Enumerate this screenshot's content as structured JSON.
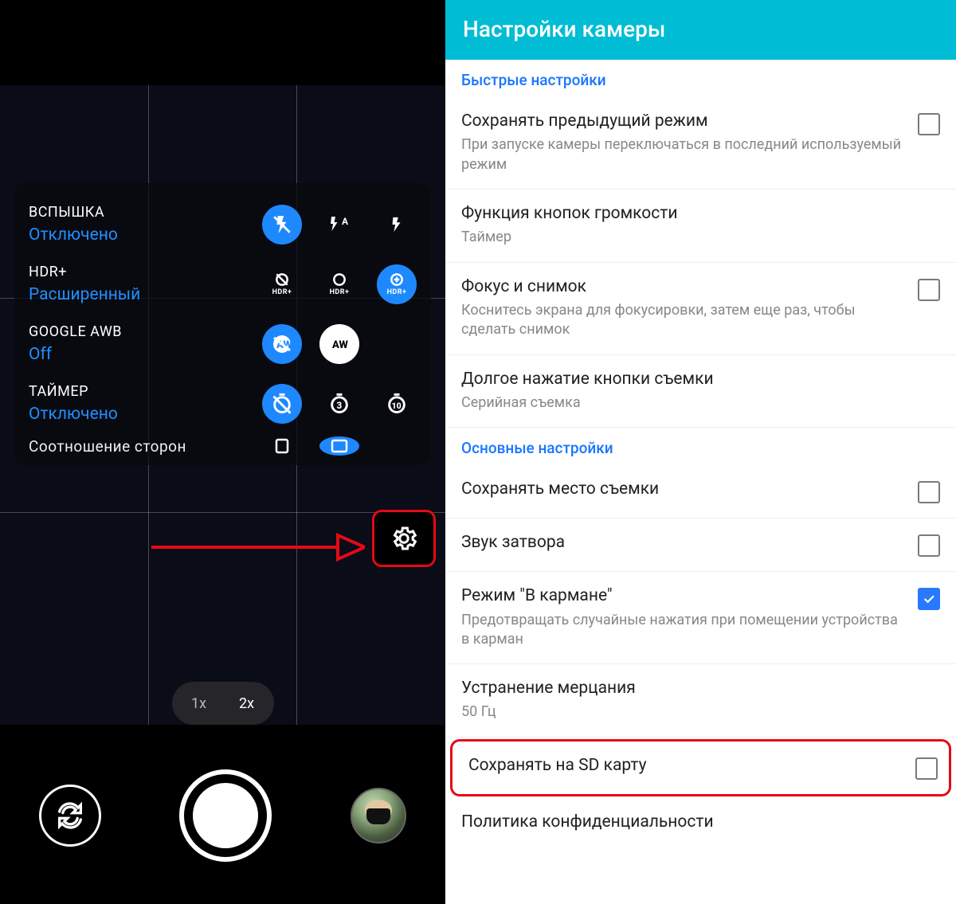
{
  "camera": {
    "quick": {
      "flash": {
        "label": "ВСПЫШКА",
        "value": "Отключено"
      },
      "hdr": {
        "label": "HDR+",
        "value": "Расширенный"
      },
      "awb": {
        "label": "GOOGLE AWB",
        "value": "Off"
      },
      "timer": {
        "label": "ТАЙМЕР",
        "value": "Отключено"
      },
      "aspect": {
        "label": "Соотношение сторон"
      }
    },
    "zoom": {
      "x1": "1x",
      "x2": "2x"
    }
  },
  "settings": {
    "appbar": "Настройки камеры",
    "section_quick": "Быстрые настройки",
    "section_main": "Основные настройки",
    "items": {
      "prev_mode": {
        "title": "Сохранять предыдущий режим",
        "sub": "При запуске камеры переключаться в последний используемый режим"
      },
      "vol_keys": {
        "title": "Функция кнопок громкости",
        "sub": "Таймер"
      },
      "focus": {
        "title": "Фокус и снимок",
        "sub": "Коснитесь экрана для фокусировки, затем еще раз, чтобы сделать снимок"
      },
      "longpress": {
        "title": "Долгое нажатие кнопки съемки",
        "sub": "Серийная съемка"
      },
      "geo": {
        "title": "Сохранять место съемки"
      },
      "shutter": {
        "title": "Звук затвора"
      },
      "pocket": {
        "title": "Режим \"В кармане\"",
        "sub": "Предотвращать случайные нажатия при помещении устройства в карман"
      },
      "flicker": {
        "title": "Устранение мерцания",
        "sub": "50 Гц"
      },
      "sd": {
        "title": "Сохранять на SD карту"
      },
      "privacy": {
        "title": "Политика конфиденциальности"
      }
    }
  }
}
